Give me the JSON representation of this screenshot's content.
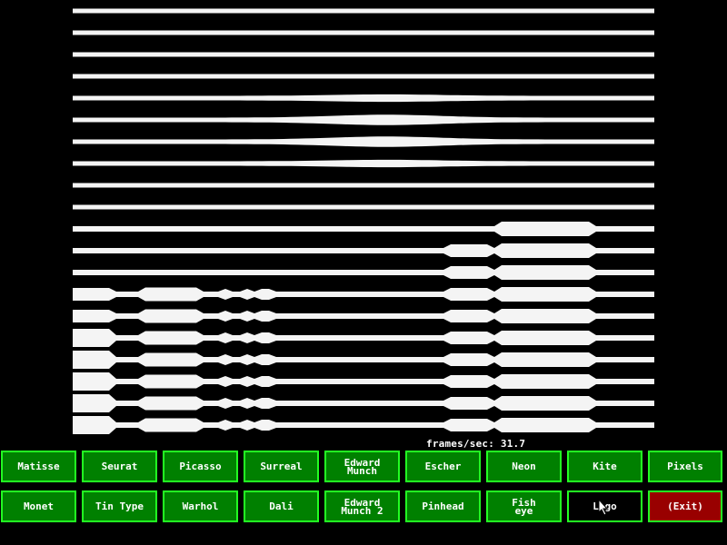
{
  "effect_view": {
    "name": "Lines",
    "stripe_count": 20
  },
  "status": {
    "fps_text": "frames/sec: 31.7"
  },
  "buttons": {
    "row1": [
      "Matisse",
      "Seurat",
      "Picasso",
      "Surreal",
      "Edward\nMunch",
      "Escher",
      "Neon",
      "Kite",
      "Pixels"
    ],
    "row2": [
      "Monet",
      "Tin Type",
      "Warhol",
      "Dali",
      "Edward\nMunch 2",
      "Pinhead",
      "Fish\neye",
      "Logo",
      "(Exit)"
    ],
    "selected": "Logo"
  },
  "colors": {
    "button_bg": "#008000",
    "button_border": "#22ff22",
    "exit_bg": "#990000",
    "fg": "#ffffff"
  }
}
